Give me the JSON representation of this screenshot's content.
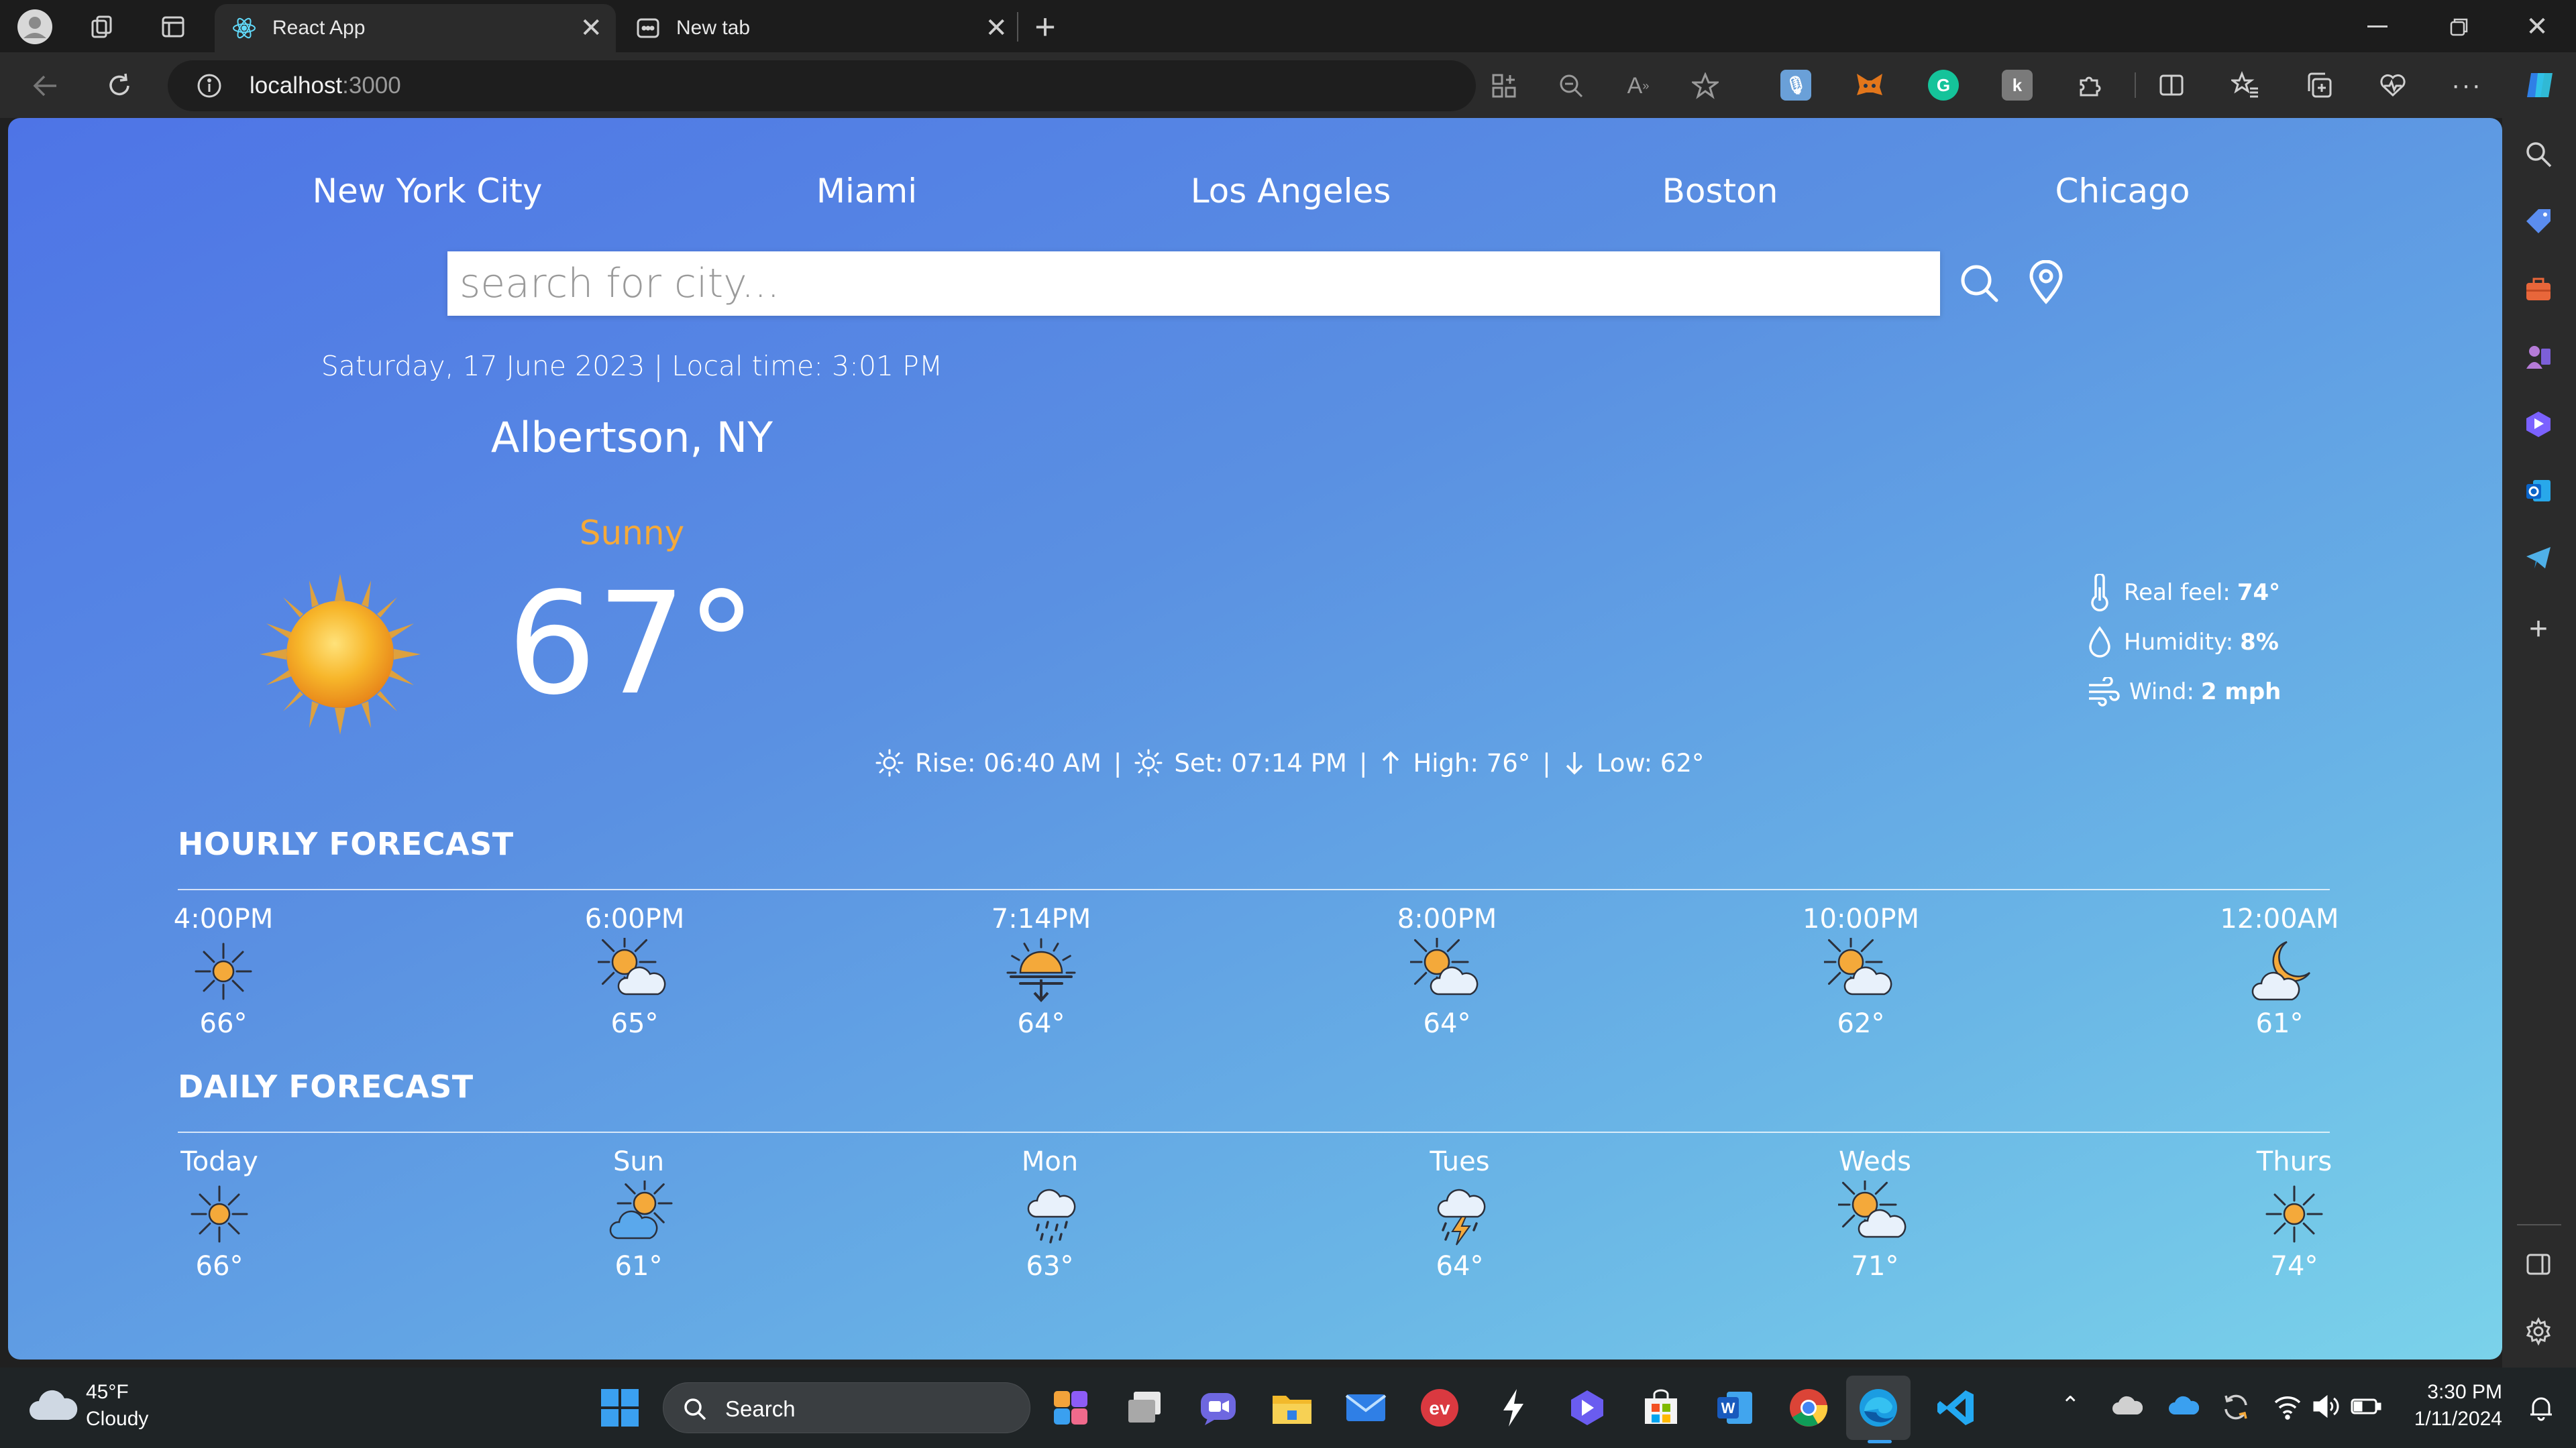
{
  "browser": {
    "tabs": [
      {
        "title": "React App",
        "active": true
      },
      {
        "title": "New tab",
        "active": false
      }
    ],
    "address": {
      "host": "localhost",
      "port": ":3000"
    }
  },
  "app": {
    "cities": [
      "New York City",
      "Miami",
      "Los Angeles",
      "Boston",
      "Chicago"
    ],
    "search_placeholder": "search for city...",
    "datetime": "Saturday, 17 June 2023 | Local time: 3:01 PM",
    "location": "Albertson, NY",
    "condition": "Sunny",
    "temperature": "67°",
    "details": {
      "real_feel_label": "Real feel:",
      "real_feel_value": "74°",
      "humidity_label": "Humidity:",
      "humidity_value": "8%",
      "wind_label": "Wind:",
      "wind_value": "2 mph"
    },
    "sun": {
      "rise": "Rise: 06:40 AM",
      "set": "Set: 07:14 PM",
      "high": "High: 76°",
      "low": "Low: 62°",
      "sep": "|"
    },
    "hourly_title": "HOURLY FORECAST",
    "hourly": [
      {
        "label": "4:00PM",
        "temp": "66°",
        "icon": "sun-icon"
      },
      {
        "label": "6:00PM",
        "temp": "65°",
        "icon": "sun-cloud-icon"
      },
      {
        "label": "7:14PM",
        "temp": "64°",
        "icon": "sunset-icon"
      },
      {
        "label": "8:00PM",
        "temp": "64°",
        "icon": "sun-cloud-icon"
      },
      {
        "label": "10:00PM",
        "temp": "62°",
        "icon": "sun-cloud-icon"
      },
      {
        "label": "12:00AM",
        "temp": "61°",
        "icon": "moon-cloud-icon"
      }
    ],
    "daily_title": "DAILY FORECAST",
    "daily": [
      {
        "label": "Today",
        "temp": "66°",
        "icon": "sun-icon"
      },
      {
        "label": "Sun",
        "temp": "61°",
        "icon": "cloud-sun-icon"
      },
      {
        "label": "Mon",
        "temp": "63°",
        "icon": "rain-cloud-icon"
      },
      {
        "label": "Tues",
        "temp": "64°",
        "icon": "thunderstorm-icon"
      },
      {
        "label": "Weds",
        "temp": "71°",
        "icon": "sun-cloud-icon"
      },
      {
        "label": "Thurs",
        "temp": "74°",
        "icon": "sun-icon"
      }
    ]
  },
  "taskbar": {
    "weather_temp": "45°F",
    "weather_desc": "Cloudy",
    "search_label": "Search",
    "time": "3:30 PM",
    "date": "1/11/2024"
  },
  "colors": {
    "accent_orange": "#f4a93a",
    "gradient_start": "#4e74e6",
    "gradient_end": "#7ad2ea"
  }
}
